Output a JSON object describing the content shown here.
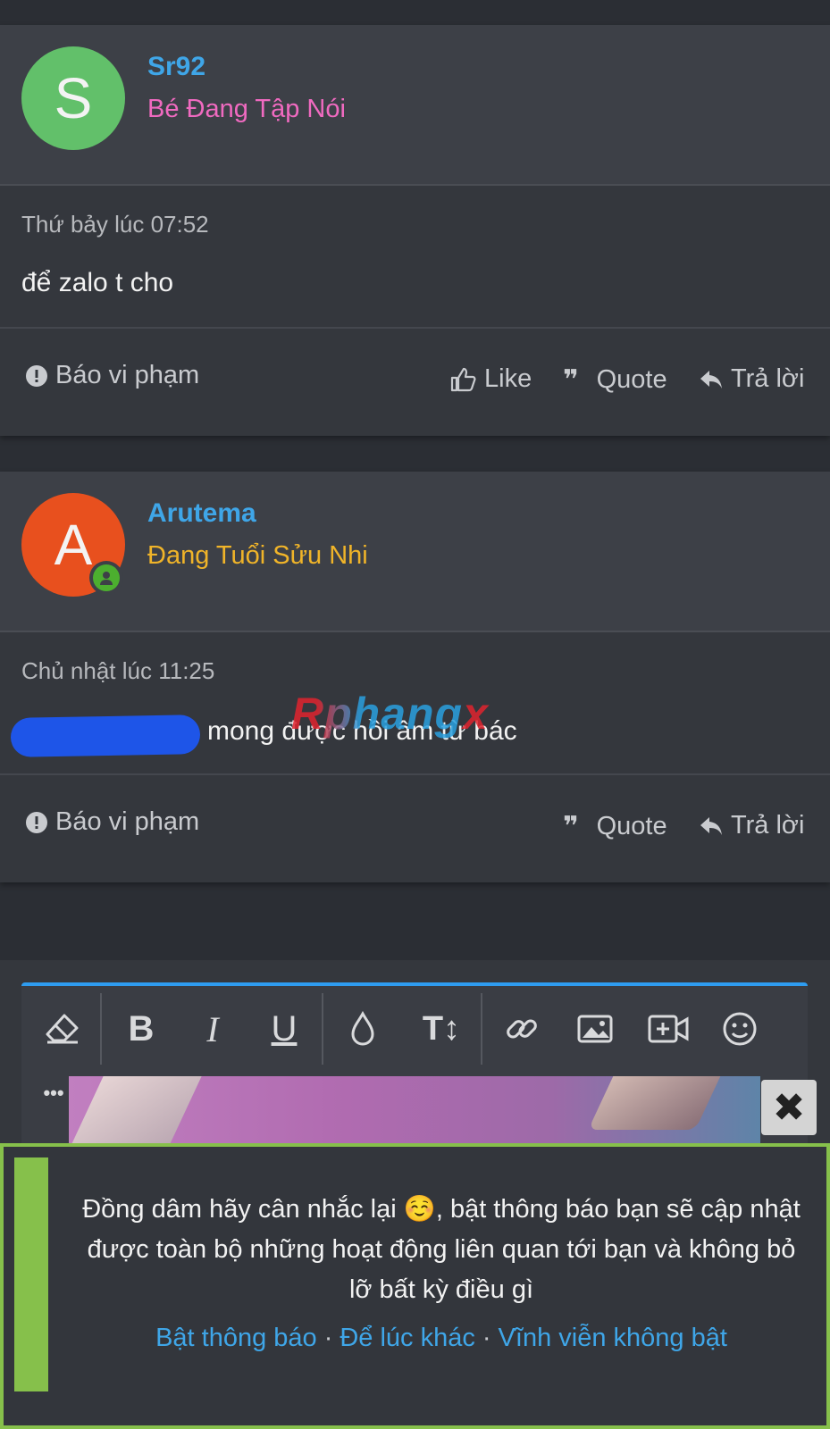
{
  "posts": [
    {
      "avatar_letter": "S",
      "avatar_color": "#62c06a",
      "username": "Sr92",
      "user_title": "Bé Đang Tập Nói",
      "user_title_color": "#f06ac0",
      "time": "Thứ bảy lúc 07:52",
      "text": "để zalo t cho",
      "actions": {
        "report": "Báo vi phạm",
        "like": "Like",
        "quote": "Quote",
        "reply": "Trả lời"
      }
    },
    {
      "avatar_letter": "A",
      "avatar_color": "#e8501e",
      "online": true,
      "username": "Arutema",
      "user_title": "Đang Tuổi Sửu Nhi",
      "user_title_color": "#f0b429",
      "time": "Chủ nhật lúc 11:25",
      "text": "mong được hồi âm từ bác",
      "actions": {
        "report": "Báo vi phạm",
        "quote": "Quote",
        "reply": "Trả lời"
      }
    }
  ],
  "watermark": {
    "prefix": "Rphang",
    "suffix": "x"
  },
  "editor": {
    "toolbar": [
      "eraser-icon",
      "bold-icon",
      "italic-icon",
      "underline-icon",
      "color-drop-icon",
      "font-size-icon",
      "link-icon",
      "image-icon",
      "video-icon",
      "smiley-icon",
      "more-icon"
    ],
    "bold_glyph": "B",
    "italic_glyph": "I",
    "underline_glyph": "U",
    "fontsize_glyph": "T↕",
    "more_glyph": "•••"
  },
  "ad": {
    "close_glyph": "✖"
  },
  "notification": {
    "message": "Đồng dâm hãy cân nhắc lại ☺️, bật thông báo bạn sẽ cập nhật được toàn bộ những hoạt động liên quan tới bạn và không bỏ lỡ bất kỳ điều gì",
    "enable": "Bật thông báo",
    "later": "Để lúc khác",
    "never": "Vĩnh viễn không bật",
    "separator": "·",
    "accent": "#86c04b",
    "link_color": "#3fa6e8"
  }
}
